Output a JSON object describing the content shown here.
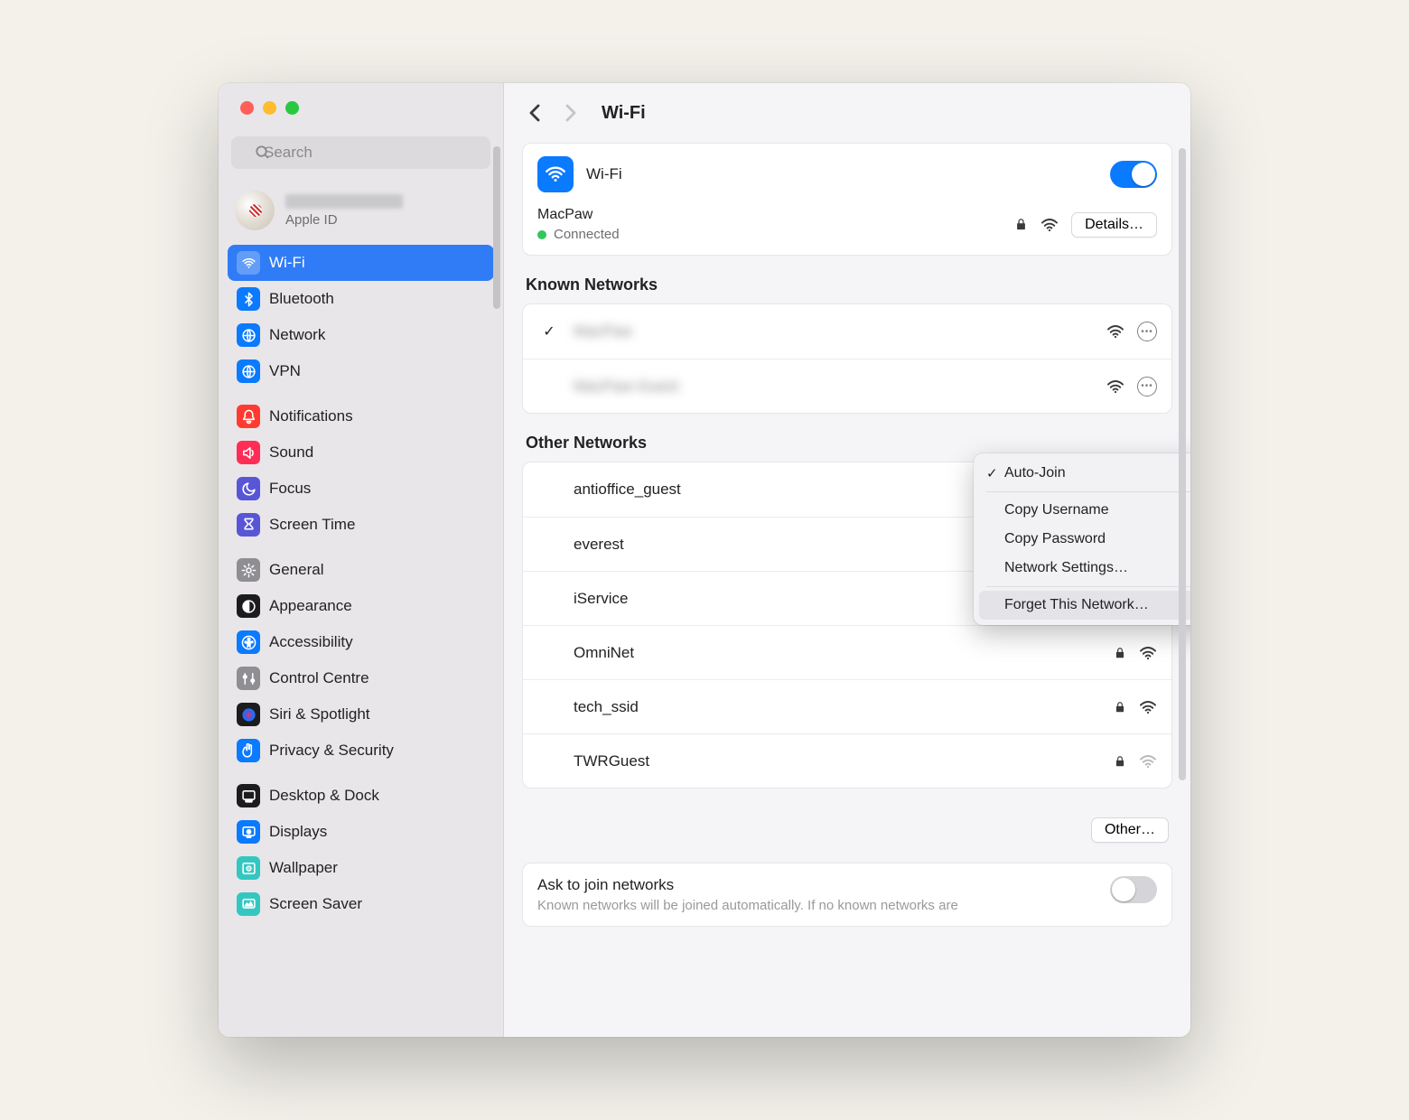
{
  "sidebar": {
    "search_placeholder": "Search",
    "account": {
      "apple_id_label": "Apple ID"
    },
    "groups": [
      {
        "items": [
          {
            "icon": "wifi",
            "color": "#0a7aff",
            "label": "Wi-Fi",
            "active": true
          },
          {
            "icon": "bluetooth",
            "color": "#0a7aff",
            "label": "Bluetooth"
          },
          {
            "icon": "network",
            "color": "#0a7aff",
            "label": "Network"
          },
          {
            "icon": "vpn",
            "color": "#0a7aff",
            "label": "VPN"
          }
        ]
      },
      {
        "items": [
          {
            "icon": "bell",
            "color": "#ff3b30",
            "label": "Notifications"
          },
          {
            "icon": "speaker",
            "color": "#ff2d55",
            "label": "Sound"
          },
          {
            "icon": "moon",
            "color": "#5856d6",
            "label": "Focus"
          },
          {
            "icon": "hourglass",
            "color": "#5856d6",
            "label": "Screen Time"
          }
        ]
      },
      {
        "items": [
          {
            "icon": "gear",
            "color": "#8e8e93",
            "label": "General"
          },
          {
            "icon": "appearance",
            "color": "#1c1c1e",
            "label": "Appearance"
          },
          {
            "icon": "accessibility",
            "color": "#0a7aff",
            "label": "Accessibility"
          },
          {
            "icon": "control",
            "color": "#8e8e93",
            "label": "Control Centre"
          },
          {
            "icon": "siri",
            "color": "#1c1c1e",
            "label": "Siri & Spotlight"
          },
          {
            "icon": "hand",
            "color": "#0a7aff",
            "label": "Privacy & Security"
          }
        ]
      },
      {
        "items": [
          {
            "icon": "dock",
            "color": "#1c1c1e",
            "label": "Desktop & Dock"
          },
          {
            "icon": "displays",
            "color": "#0a7aff",
            "label": "Displays"
          },
          {
            "icon": "wallpaper",
            "color": "#34c7c1",
            "label": "Wallpaper"
          },
          {
            "icon": "screensaver",
            "color": "#34c7c1",
            "label": "Screen Saver"
          }
        ]
      }
    ]
  },
  "header": {
    "title": "Wi-Fi"
  },
  "wifi_card": {
    "label": "Wi-Fi",
    "enabled": true,
    "current_network": "MacPaw",
    "status": "Connected",
    "details_button": "Details…"
  },
  "known_networks": {
    "title": "Known Networks",
    "items": [
      {
        "name": "MacPaw",
        "checked": true,
        "locked": false,
        "blurred": true,
        "strong": true
      },
      {
        "name": "MacPaw-Guest",
        "checked": false,
        "locked": false,
        "blurred": true,
        "strong": true
      }
    ]
  },
  "other_networks": {
    "title": "Other Networks",
    "items": [
      {
        "name": "antioffice_guest",
        "locked": false,
        "strong": true
      },
      {
        "name": "everest",
        "locked": true,
        "strong": false
      },
      {
        "name": "iService",
        "locked": true,
        "strong": false
      },
      {
        "name": "OmniNet",
        "locked": true,
        "strong": true
      },
      {
        "name": "tech_ssid",
        "locked": true,
        "strong": true
      },
      {
        "name": "TWRGuest",
        "locked": true,
        "strong": false
      }
    ],
    "other_button": "Other…"
  },
  "ask_section": {
    "title": "Ask to join networks",
    "description": "Known networks will be joined automatically. If no known networks are",
    "enabled": false
  },
  "context_menu": {
    "items": [
      {
        "label": "Auto-Join",
        "checked": true
      },
      {
        "label": "Copy Username"
      },
      {
        "label": "Copy Password"
      },
      {
        "label": "Network Settings…"
      },
      {
        "label": "Forget This Network…",
        "hover": true
      }
    ]
  }
}
